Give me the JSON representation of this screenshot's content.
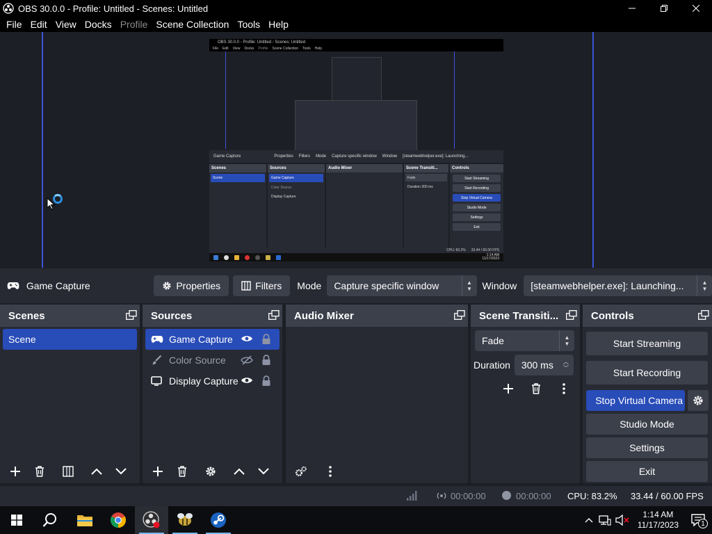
{
  "window": {
    "title": "OBS 30.0.0 - Profile: Untitled - Scenes: Untitled"
  },
  "menu": [
    "File",
    "Edit",
    "View",
    "Docks",
    "Profile",
    "Scene Collection",
    "Tools",
    "Help"
  ],
  "menu_disabled": [
    "Profile"
  ],
  "capture_preview": {
    "title": "OBS 30.0.0 - Profile: Untitled - Scenes: Untitled",
    "menu": [
      "File",
      "Edit",
      "View",
      "Docks",
      "Profile",
      "Scene Collection",
      "Tools",
      "Help"
    ],
    "props": {
      "source": "Game Capture",
      "properties": "Properties",
      "filters": "Filters",
      "mode_label": "Mode",
      "mode_value": "Capture specific window",
      "window_label": "Window",
      "window_value": "[steamwebhelper.exe]: Launching..."
    },
    "docks": {
      "scenes": {
        "title": "Scenes",
        "items": [
          "Scene"
        ]
      },
      "sources": {
        "title": "Sources",
        "items": [
          "Game Capture",
          "Color Source",
          "Display Capture"
        ]
      },
      "audio": {
        "title": "Audio Mixer"
      },
      "transitions": {
        "title": "Scene Transiti...",
        "value": "Fade",
        "duration_label": "Duration",
        "duration_value": "300 ms"
      },
      "controls": {
        "title": "Controls",
        "buttons": [
          "Start Streaming",
          "Start Recording",
          "Stop Virtual Camera",
          "Studio Mode",
          "Settings",
          "Exit"
        ]
      }
    },
    "status": {
      "cpu": "CPU: 83.2%",
      "fps": "33.44 / 60.00 FPS"
    },
    "clock": {
      "time": "1:14 AM",
      "date": "11/17/2023"
    }
  },
  "propbar": {
    "source_name": "Game Capture",
    "properties_label": "Properties",
    "filters_label": "Filters",
    "mode_label": "Mode",
    "mode_value": "Capture specific window",
    "window_label": "Window",
    "window_value": "[steamwebhelper.exe]: Launching..."
  },
  "scenes": {
    "title": "Scenes",
    "items": [
      {
        "name": "Scene",
        "selected": true
      }
    ]
  },
  "sources": {
    "title": "Sources",
    "items": [
      {
        "name": "Game Capture",
        "icon": "gamepad-icon",
        "visible": true,
        "locked": false,
        "selected": true
      },
      {
        "name": "Color Source",
        "icon": "paintbrush-icon",
        "visible": false,
        "locked": false,
        "selected": false
      },
      {
        "name": "Display Capture",
        "icon": "monitor-icon",
        "visible": true,
        "locked": false,
        "selected": false
      }
    ]
  },
  "audio_mixer": {
    "title": "Audio Mixer"
  },
  "transitions": {
    "title": "Scene Transiti...",
    "transition_value": "Fade",
    "duration_label": "Duration",
    "duration_value": "300 ms"
  },
  "controls": {
    "title": "Controls",
    "start_streaming": "Start Streaming",
    "start_recording": "Start Recording",
    "virtual_camera": "Stop Virtual Camera",
    "studio_mode": "Studio Mode",
    "settings": "Settings",
    "exit": "Exit"
  },
  "statusbar": {
    "stream_time": "00:00:00",
    "record_time": "00:00:00",
    "cpu": "CPU: 83.2%",
    "fps": "33.44 / 60.00 FPS"
  },
  "taskbar": {
    "apps": [
      "windows-start-icon",
      "search-icon",
      "file-explorer-icon",
      "chrome-icon",
      "obs-icon",
      "bee-app-icon",
      "steam-icon"
    ],
    "clock_time": "1:14 AM",
    "clock_date": "11/17/2023",
    "notification_count": "1"
  },
  "colors": {
    "accent": "#284cb8",
    "panel": "#272a33",
    "header": "#3c404b",
    "background": "#1d1f26",
    "preview_guide": "#3b55d8"
  }
}
